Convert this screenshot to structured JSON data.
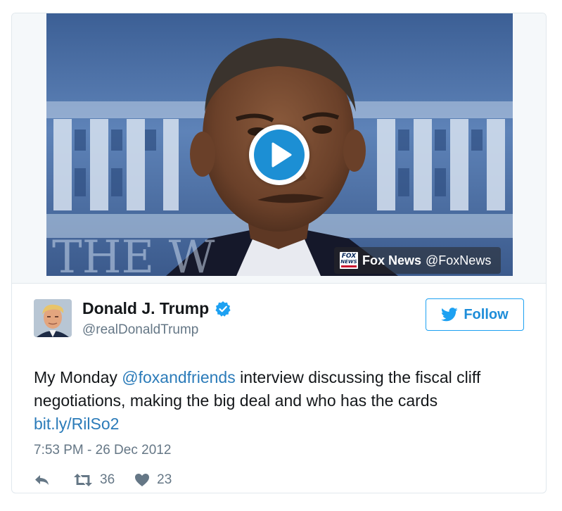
{
  "media": {
    "attribution_name": "Fox News",
    "attribution_handle": "@FoxNews",
    "logo_text_top": "FOX",
    "logo_text_bottom": "NEWS",
    "play_icon": "play-icon"
  },
  "author": {
    "display_name": "Donald J. Trump",
    "screen_name": "@realDonaldTrump",
    "verified": true,
    "verified_icon": "verified-badge-icon",
    "avatar_icon": "avatar"
  },
  "follow_button": {
    "label": "Follow",
    "icon": "twitter-bird-icon"
  },
  "tweet": {
    "text_prefix": "My Monday ",
    "mention": "@foxandfriends",
    "text_suffix": " interview discussing the fiscal cliff negotiations, making the big deal and who has the cards",
    "link": "bit.ly/RilSo2",
    "timestamp": "7:53 PM - 26 Dec 2012"
  },
  "actions": {
    "reply_icon": "reply-icon",
    "retweet_icon": "retweet-icon",
    "retweet_count": "36",
    "like_icon": "heart-icon",
    "like_count": "23"
  },
  "colors": {
    "twitter_blue": "#1da1f2",
    "link_blue": "#2b7bb9",
    "text_primary": "#14171a",
    "text_secondary": "#657786",
    "border": "#e1e8ed",
    "play_blue": "#1c8fd4"
  }
}
